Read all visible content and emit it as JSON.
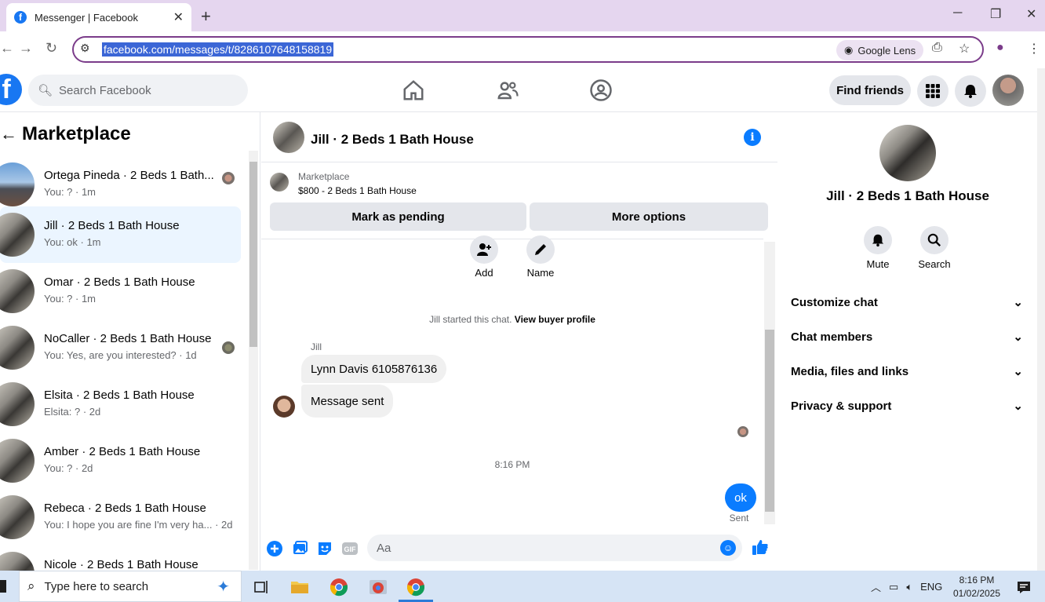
{
  "browser": {
    "tab_title": "Messenger | Facebook",
    "url": "facebook.com/messages/t/8286107648158819",
    "lens_label": "Google Lens"
  },
  "fb_header": {
    "search_placeholder": "Search Facebook",
    "find_friends": "Find friends"
  },
  "sidebar": {
    "title": "Marketplace",
    "conversations": [
      {
        "name": "Ortega Pineda · 2 Beds 1 Bath...",
        "preview": "You: ? · 1m",
        "active": false
      },
      {
        "name": "Jill · 2 Beds 1 Bath House",
        "preview": "You: ok · 1m",
        "active": true
      },
      {
        "name": "Omar · 2 Beds 1 Bath House",
        "preview": "You: ? · 1m",
        "active": false
      },
      {
        "name": "NoCaller · 2 Beds 1 Bath House",
        "preview": "You: Yes, are you interested? · 1d",
        "active": false
      },
      {
        "name": "Elsita · 2 Beds 1 Bath House",
        "preview": "Elsita: ? · 2d",
        "active": false
      },
      {
        "name": "Amber · 2 Beds 1 Bath House",
        "preview": "You: ? · 2d",
        "active": false
      },
      {
        "name": "Rebeca · 2 Beds 1 Bath House",
        "preview": "You: I hope you are fine I'm very ha... · 2d",
        "active": false
      },
      {
        "name": "Nicole · 2 Beds 1 Bath House",
        "preview": "",
        "active": false
      }
    ]
  },
  "chat": {
    "title": "Jill · 2 Beds 1 Bath House",
    "marketplace_label": "Marketplace",
    "listing": "$800 - 2 Beds 1 Bath House",
    "mark_pending": "Mark as pending",
    "more_options": "More options",
    "add_label": "Add",
    "name_label": "Name",
    "started_text": "Jill started this chat.",
    "view_buyer": "View buyer profile",
    "sender": "Jill",
    "messages_in": [
      "Lynn Davis 6105876136",
      "Message sent"
    ],
    "timestamp": "8:16 PM",
    "message_out": "ok",
    "status": "Sent",
    "input_placeholder": "Aa"
  },
  "details": {
    "title": "Jill · 2 Beds 1 Bath House",
    "mute": "Mute",
    "search": "Search",
    "sections": [
      "Customize chat",
      "Chat members",
      "Media, files and links",
      "Privacy & support"
    ]
  },
  "taskbar": {
    "search_placeholder": "Type here to search",
    "language": "ENG",
    "time": "8:16 PM",
    "date": "01/02/2025"
  }
}
